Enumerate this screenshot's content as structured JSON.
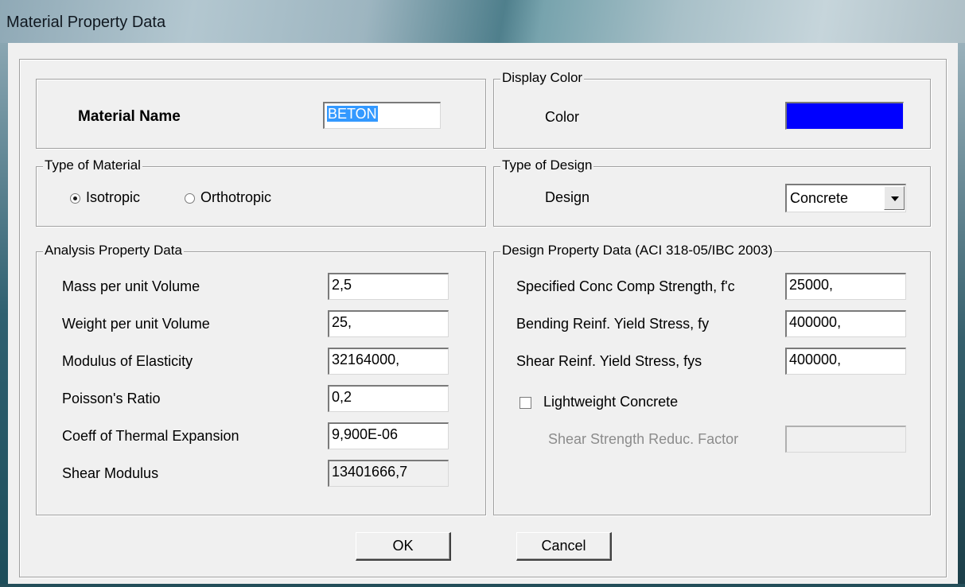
{
  "window": {
    "title": "Material Property Data"
  },
  "material": {
    "label": "Material Name",
    "value": "BETON"
  },
  "display_color": {
    "legend": "Display Color",
    "label": "Color",
    "swatch_color": "#0000ff"
  },
  "type_of_material": {
    "legend": "Type of Material",
    "options": [
      "Isotropic",
      "Orthotropic"
    ],
    "selected": "Isotropic"
  },
  "type_of_design": {
    "legend": "Type of Design",
    "label": "Design",
    "value": "Concrete"
  },
  "analysis": {
    "legend": "Analysis Property Data",
    "rows": [
      {
        "label": "Mass per unit Volume",
        "value": "2,5"
      },
      {
        "label": "Weight per unit Volume",
        "value": "25,"
      },
      {
        "label": "Modulus of Elasticity",
        "value": "32164000,"
      },
      {
        "label": "Poisson's Ratio",
        "value": "0,2"
      },
      {
        "label": "Coeff of Thermal Expansion",
        "value": "9,900E-06"
      },
      {
        "label": "Shear Modulus",
        "value": "13401666,7"
      }
    ]
  },
  "design_props": {
    "legend": "Design Property Data (ACI 318-05/IBC 2003)",
    "rows": [
      {
        "label": "Specified Conc Comp Strength, f'c",
        "value": "25000,"
      },
      {
        "label": "Bending Reinf. Yield Stress, fy",
        "value": "400000,"
      },
      {
        "label": "Shear Reinf. Yield Stress, fys",
        "value": "400000,"
      }
    ],
    "lightweight_label": "Lightweight Concrete",
    "lightweight_checked": false,
    "shear_reduc_label": "Shear Strength Reduc. Factor",
    "shear_reduc_value": ""
  },
  "buttons": {
    "ok": "OK",
    "cancel": "Cancel"
  }
}
